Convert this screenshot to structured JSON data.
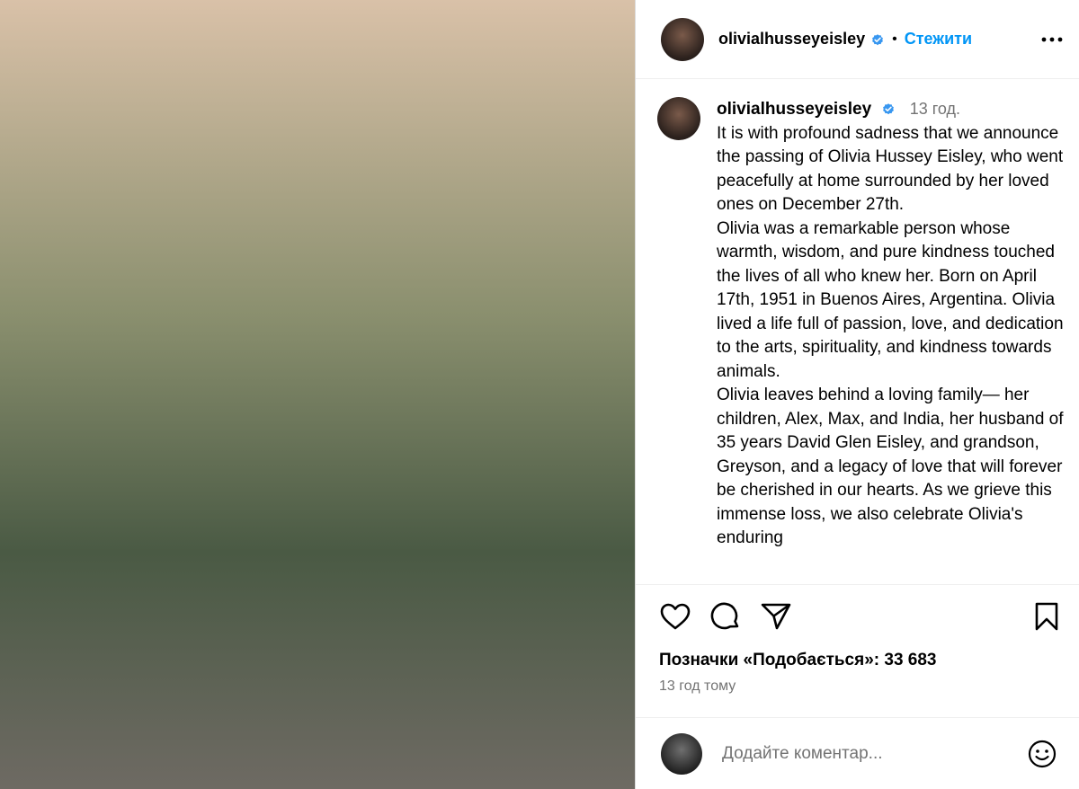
{
  "post": {
    "username": "olivialhusseyeisley",
    "follow_label": "Стежити",
    "separator": "•"
  },
  "caption": {
    "username": "olivialhusseyeisley",
    "time": "13 год.",
    "paragraphs": [
      "It is with profound sadness that we announce the passing of Olivia Hussey Eisley, who went peacefully at home surrounded by her loved ones on December 27th.",
      "Olivia was a remarkable person whose warmth, wisdom, and pure kindness touched the lives of all who knew her. Born on April 17th, 1951 in Buenos Aires, Argentina. Olivia lived a life full of passion, love, and dedication to the arts, spirituality, and kindness towards animals.",
      "Olivia leaves behind a loving family— her children, Alex, Max, and India, her husband of 35 years David Glen Eisley, and grandson, Greyson, and a legacy of love that will forever be cherished in our hearts. As we grieve this immense loss, we also celebrate Olivia's enduring"
    ]
  },
  "likes": {
    "text": "Позначки «Подобається»: 33 683"
  },
  "posted_ago": "13 год тому",
  "comment": {
    "placeholder": "Додайте коментар..."
  },
  "colors": {
    "accent": "#0095f6",
    "verified": "#3897f0",
    "muted": "#737373"
  },
  "icons": [
    "verified-badge-icon",
    "more-options-icon",
    "heart-icon",
    "comment-icon",
    "share-icon",
    "bookmark-icon",
    "emoji-icon"
  ]
}
